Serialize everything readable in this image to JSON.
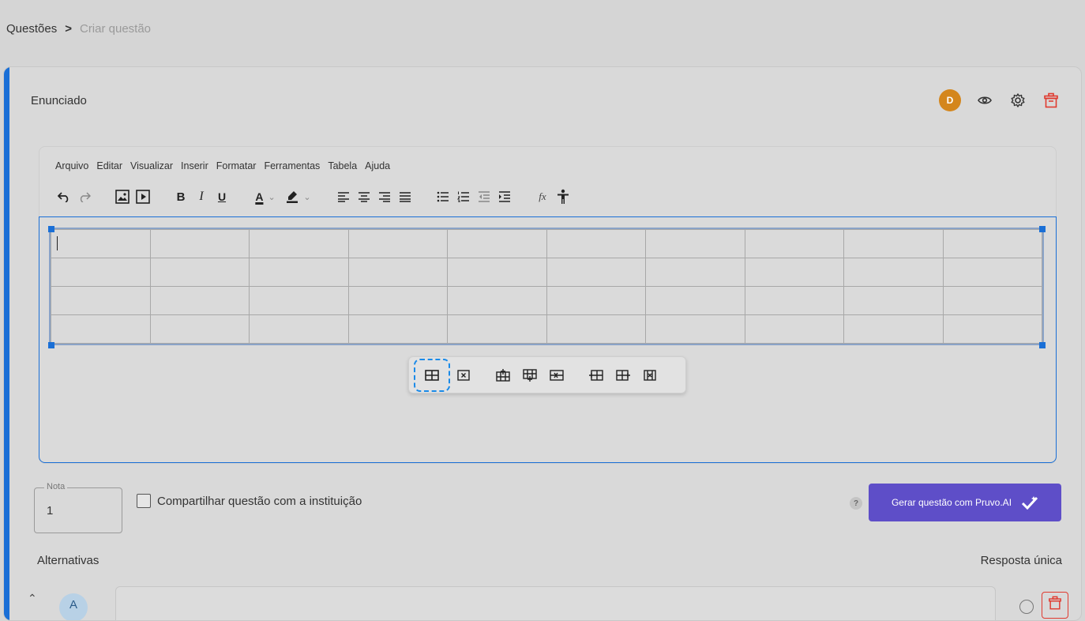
{
  "breadcrumb": {
    "parent": "Questões",
    "separator": ">",
    "current": "Criar questão"
  },
  "statement": {
    "title": "Enunciado",
    "avatar_initial": "D"
  },
  "editor": {
    "menu": [
      "Arquivo",
      "Editar",
      "Visualizar",
      "Inserir",
      "Formatar",
      "Ferramentas",
      "Tabela",
      "Ajuda"
    ],
    "toolbar_icons": [
      "undo-icon",
      "redo-icon",
      "image-icon",
      "media-icon",
      "bold-icon",
      "italic-icon",
      "underline-icon",
      "text-color-icon",
      "highlight-color-icon",
      "align-left-icon",
      "align-center-icon",
      "align-right-icon",
      "justify-icon",
      "bullet-list-icon",
      "numbered-list-icon",
      "outdent-icon",
      "indent-icon",
      "formula-icon",
      "accessibility-icon"
    ],
    "toolbar_text": {
      "bold": "B",
      "italic": "I",
      "underline": "U",
      "text_color": "A",
      "formula": "fx"
    },
    "table": {
      "rows": 4,
      "cols": 10
    },
    "table_popup_icons": [
      "table-properties-icon",
      "delete-table-icon",
      "insert-row-before-icon",
      "insert-row-after-icon",
      "delete-row-icon",
      "insert-col-before-icon",
      "insert-col-after-icon",
      "delete-col-icon"
    ]
  },
  "nota": {
    "label": "Nota",
    "value": "1"
  },
  "share": {
    "label": "Compartilhar questão com a instituição"
  },
  "help": {
    "symbol": "?"
  },
  "ai_button": {
    "label": "Gerar questão com Pruvo.AI"
  },
  "alternatives": {
    "label": "Alternativas",
    "mode": "Resposta única",
    "first_letter": "A"
  }
}
